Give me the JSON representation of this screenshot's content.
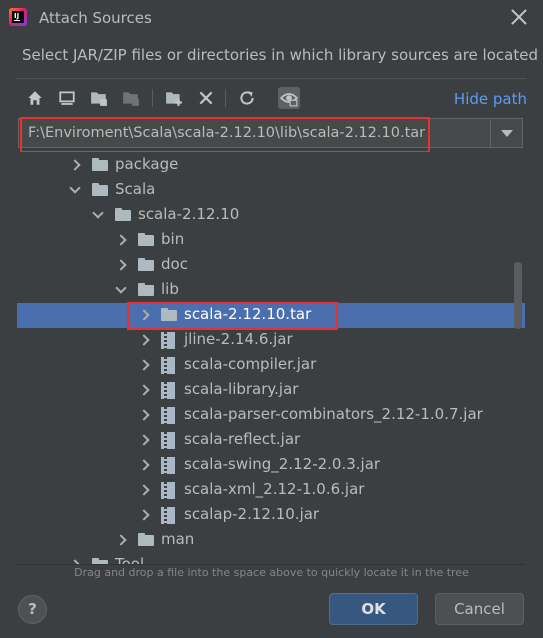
{
  "window": {
    "title": "Attach Sources",
    "logo_text": "IJ"
  },
  "description": "Select JAR/ZIP files or directories in which library sources are located",
  "toolbar": {
    "icons": [
      "home-icon",
      "desktop-icon",
      "project-folder-icon",
      "module-folder-icon",
      "new-folder-icon",
      "delete-icon",
      "refresh-icon",
      "show-hidden-icon"
    ],
    "hide_path_label": "Hide path"
  },
  "path": {
    "value": "F:\\Enviroment\\Scala\\scala-2.12.10\\lib\\scala-2.12.10.tar"
  },
  "tree": {
    "rows": [
      {
        "label": "package",
        "type": "folder",
        "expanded": false
      },
      {
        "label": "Scala",
        "type": "folder",
        "expanded": true
      },
      {
        "label": "scala-2.12.10",
        "type": "folder",
        "expanded": true
      },
      {
        "label": "bin",
        "type": "folder",
        "expanded": false
      },
      {
        "label": "doc",
        "type": "folder",
        "expanded": false
      },
      {
        "label": "lib",
        "type": "folder",
        "expanded": true
      },
      {
        "label": "scala-2.12.10.tar",
        "type": "folder",
        "expanded": false,
        "selected": true
      },
      {
        "label": "jline-2.14.6.jar",
        "type": "jar",
        "expanded": false
      },
      {
        "label": "scala-compiler.jar",
        "type": "jar",
        "expanded": false
      },
      {
        "label": "scala-library.jar",
        "type": "jar",
        "expanded": false
      },
      {
        "label": "scala-parser-combinators_2.12-1.0.7.jar",
        "type": "jar",
        "expanded": false
      },
      {
        "label": "scala-reflect.jar",
        "type": "jar",
        "expanded": false
      },
      {
        "label": "scala-swing_2.12-2.0.3.jar",
        "type": "jar",
        "expanded": false
      },
      {
        "label": "scala-xml_2.12-1.0.6.jar",
        "type": "jar",
        "expanded": false
      },
      {
        "label": "scalap-2.12.10.jar",
        "type": "jar",
        "expanded": false
      },
      {
        "label": "man",
        "type": "folder",
        "expanded": false
      },
      {
        "label": "Tool",
        "type": "folder",
        "expanded": false
      }
    ]
  },
  "hint": "Drag and drop a file into the space above to quickly locate it in the tree",
  "buttons": {
    "help": "?",
    "ok": "OK",
    "cancel": "Cancel"
  },
  "colors": {
    "background": "#3c3f41",
    "selection": "#4b6eaf",
    "link": "#589df6",
    "highlight_box": "#e83030",
    "ok_button": "#365880"
  }
}
